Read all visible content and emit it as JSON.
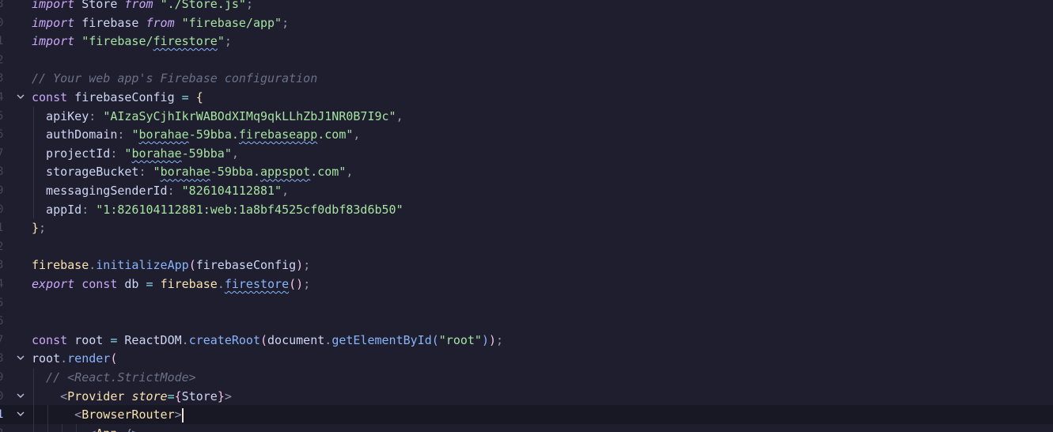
{
  "editor": {
    "lines": [
      {
        "ln": "8",
        "fold": false,
        "current": false,
        "tokens": [
          {
            "t": "import",
            "c": "kwi"
          },
          {
            "t": " Store ",
            "c": "plain"
          },
          {
            "t": "from",
            "c": "kwi"
          },
          {
            "t": " ",
            "c": "plain"
          },
          {
            "t": "\"./Store.js\"",
            "c": "str"
          },
          {
            "t": ";",
            "c": "punc"
          }
        ]
      },
      {
        "ln": "0",
        "fold": false,
        "current": false,
        "tokens": [
          {
            "t": "import",
            "c": "kwi"
          },
          {
            "t": " firebase ",
            "c": "plain"
          },
          {
            "t": "from",
            "c": "kwi"
          },
          {
            "t": " ",
            "c": "plain"
          },
          {
            "t": "\"firebase/app\"",
            "c": "str"
          },
          {
            "t": ";",
            "c": "punc"
          }
        ]
      },
      {
        "ln": "1",
        "fold": false,
        "current": false,
        "tokens": [
          {
            "t": "import",
            "c": "kwi"
          },
          {
            "t": " ",
            "c": "plain"
          },
          {
            "t": "\"firebase/",
            "c": "str"
          },
          {
            "t": "firestore",
            "c": "str",
            "sq": true
          },
          {
            "t": "\"",
            "c": "str"
          },
          {
            "t": ";",
            "c": "punc"
          }
        ]
      },
      {
        "ln": "2",
        "fold": false,
        "current": false,
        "tokens": []
      },
      {
        "ln": "3",
        "fold": false,
        "current": false,
        "tokens": [
          {
            "t": "// Your web app's Firebase configuration",
            "c": "com"
          }
        ]
      },
      {
        "ln": "4",
        "fold": true,
        "current": false,
        "tokens": [
          {
            "t": "const",
            "c": "kw"
          },
          {
            "t": " firebaseConfig ",
            "c": "plain"
          },
          {
            "t": "=",
            "c": "op"
          },
          {
            "t": " ",
            "c": "plain"
          },
          {
            "t": "{",
            "c": "brace"
          }
        ]
      },
      {
        "ln": "5",
        "fold": false,
        "current": false,
        "tokens": [
          {
            "t": "  apiKey",
            "c": "prop"
          },
          {
            "t": ": ",
            "c": "punc"
          },
          {
            "t": "\"AIzaSyCjhIkrWABOdXIMq9qkLLhZbJ1NR0B7I9c\"",
            "c": "str"
          },
          {
            "t": ",",
            "c": "punc"
          }
        ]
      },
      {
        "ln": "6",
        "fold": false,
        "current": false,
        "tokens": [
          {
            "t": "  authDomain",
            "c": "prop"
          },
          {
            "t": ": ",
            "c": "punc"
          },
          {
            "t": "\"",
            "c": "str"
          },
          {
            "t": "borahae",
            "c": "str",
            "sq": true
          },
          {
            "t": "-59bba.",
            "c": "str"
          },
          {
            "t": "firebaseapp",
            "c": "str",
            "sq": true
          },
          {
            "t": ".com\"",
            "c": "str"
          },
          {
            "t": ",",
            "c": "punc"
          }
        ]
      },
      {
        "ln": "7",
        "fold": false,
        "current": false,
        "tokens": [
          {
            "t": "  projectId",
            "c": "prop"
          },
          {
            "t": ": ",
            "c": "punc"
          },
          {
            "t": "\"",
            "c": "str"
          },
          {
            "t": "borahae",
            "c": "str",
            "sq": true
          },
          {
            "t": "-59bba\"",
            "c": "str"
          },
          {
            "t": ",",
            "c": "punc"
          }
        ]
      },
      {
        "ln": "8",
        "fold": false,
        "current": false,
        "tokens": [
          {
            "t": "  storageBucket",
            "c": "prop"
          },
          {
            "t": ": ",
            "c": "punc"
          },
          {
            "t": "\"",
            "c": "str"
          },
          {
            "t": "borahae",
            "c": "str",
            "sq": true
          },
          {
            "t": "-59bba.",
            "c": "str"
          },
          {
            "t": "appspot",
            "c": "str",
            "sq": true
          },
          {
            "t": ".com\"",
            "c": "str"
          },
          {
            "t": ",",
            "c": "punc"
          }
        ]
      },
      {
        "ln": "9",
        "fold": false,
        "current": false,
        "tokens": [
          {
            "t": "  messagingSenderId",
            "c": "prop"
          },
          {
            "t": ": ",
            "c": "punc"
          },
          {
            "t": "\"826104112881\"",
            "c": "str"
          },
          {
            "t": ",",
            "c": "punc"
          }
        ]
      },
      {
        "ln": "0",
        "fold": false,
        "current": false,
        "tokens": [
          {
            "t": "  appId",
            "c": "prop"
          },
          {
            "t": ": ",
            "c": "punc"
          },
          {
            "t": "\"1:826104112881:web:1a8bf4525cf0dbf83d6b50\"",
            "c": "str"
          }
        ]
      },
      {
        "ln": "1",
        "fold": false,
        "current": false,
        "tokens": [
          {
            "t": "}",
            "c": "brace"
          },
          {
            "t": ";",
            "c": "punc"
          }
        ]
      },
      {
        "ln": "2",
        "fold": false,
        "current": false,
        "tokens": []
      },
      {
        "ln": "3",
        "fold": false,
        "current": false,
        "tokens": [
          {
            "t": "firebase",
            "c": "ns"
          },
          {
            "t": ".",
            "c": "punc"
          },
          {
            "t": "initializeApp",
            "c": "fn"
          },
          {
            "t": "(",
            "c": "paren"
          },
          {
            "t": "firebaseConfig",
            "c": "plain"
          },
          {
            "t": ")",
            "c": "paren"
          },
          {
            "t": ";",
            "c": "punc"
          }
        ]
      },
      {
        "ln": "4",
        "fold": false,
        "current": false,
        "tokens": [
          {
            "t": "export",
            "c": "kwi"
          },
          {
            "t": " ",
            "c": "plain"
          },
          {
            "t": "const",
            "c": "kw"
          },
          {
            "t": " db ",
            "c": "plain"
          },
          {
            "t": "=",
            "c": "op"
          },
          {
            "t": " ",
            "c": "plain"
          },
          {
            "t": "firebase",
            "c": "ns"
          },
          {
            "t": ".",
            "c": "punc"
          },
          {
            "t": "firestore",
            "c": "fn",
            "sq": true
          },
          {
            "t": "()",
            "c": "paren"
          },
          {
            "t": ";",
            "c": "punc"
          }
        ]
      },
      {
        "ln": "5",
        "fold": false,
        "current": false,
        "tokens": []
      },
      {
        "ln": "6",
        "fold": false,
        "current": false,
        "tokens": []
      },
      {
        "ln": "7",
        "fold": false,
        "current": false,
        "tokens": [
          {
            "t": "const",
            "c": "kw"
          },
          {
            "t": " root ",
            "c": "plain"
          },
          {
            "t": "=",
            "c": "op"
          },
          {
            "t": " ReactDOM",
            "c": "plain"
          },
          {
            "t": ".",
            "c": "punc"
          },
          {
            "t": "createRoot",
            "c": "fn"
          },
          {
            "t": "(",
            "c": "paren"
          },
          {
            "t": "document",
            "c": "plain"
          },
          {
            "t": ".",
            "c": "punc"
          },
          {
            "t": "getElementById",
            "c": "fn"
          },
          {
            "t": "(",
            "c": "paren2"
          },
          {
            "t": "\"root\"",
            "c": "str"
          },
          {
            "t": ")",
            "c": "paren2"
          },
          {
            "t": ")",
            "c": "paren"
          },
          {
            "t": ";",
            "c": "punc"
          }
        ]
      },
      {
        "ln": "8",
        "fold": true,
        "current": false,
        "tokens": [
          {
            "t": "root",
            "c": "plain"
          },
          {
            "t": ".",
            "c": "punc"
          },
          {
            "t": "render",
            "c": "fn"
          },
          {
            "t": "(",
            "c": "paren"
          }
        ]
      },
      {
        "ln": "9",
        "fold": false,
        "current": false,
        "tokens": [
          {
            "t": "  // <React.StrictMode>",
            "c": "com"
          }
        ]
      },
      {
        "ln": "0",
        "fold": true,
        "current": false,
        "tokens": [
          {
            "t": "    <",
            "c": "punc"
          },
          {
            "t": "Provider",
            "c": "tag"
          },
          {
            "t": " ",
            "c": "plain"
          },
          {
            "t": "store",
            "c": "attr"
          },
          {
            "t": "=",
            "c": "op"
          },
          {
            "t": "{",
            "c": "paren"
          },
          {
            "t": "Store",
            "c": "plain"
          },
          {
            "t": "}",
            "c": "paren"
          },
          {
            "t": ">",
            "c": "punc"
          }
        ]
      },
      {
        "ln": "1",
        "fold": true,
        "current": true,
        "tokens": [
          {
            "t": "      <",
            "c": "punc"
          },
          {
            "t": "BrowserRouter",
            "c": "tag"
          },
          {
            "t": ">",
            "c": "punc"
          }
        ]
      },
      {
        "ln": "2",
        "fold": false,
        "current": false,
        "tokens": [
          {
            "t": "        <",
            "c": "punc"
          },
          {
            "t": "App",
            "c": "tag"
          },
          {
            "t": " />",
            "c": "punc"
          }
        ]
      }
    ]
  }
}
